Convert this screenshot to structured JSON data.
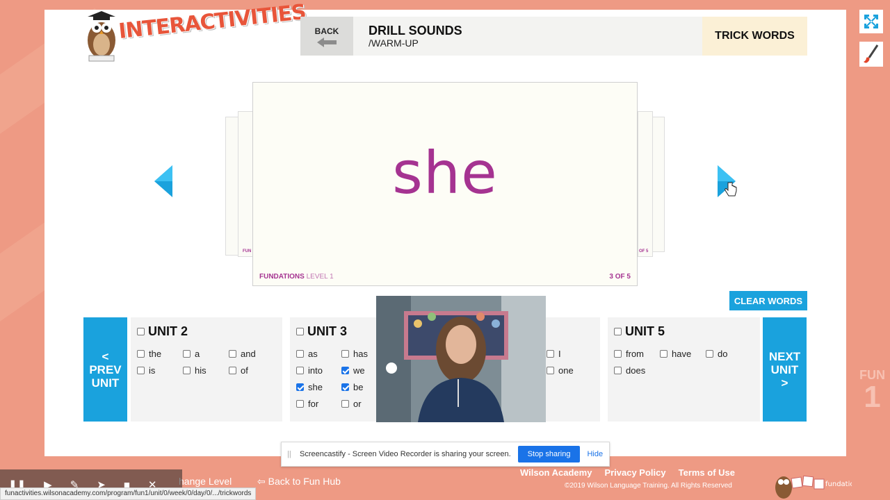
{
  "app": {
    "logo_text": "INTERACTIVITIES"
  },
  "header": {
    "back_label": "BACK",
    "title": "DRILL SOUNDS",
    "subtitle": "/WARM-UP",
    "tab_label": "TRICK WORDS"
  },
  "card": {
    "word": "she",
    "brand": "FUNDATIONS",
    "level": "LEVEL 1",
    "position": "3 OF 5",
    "ghost_label_left": "FUN",
    "ghost_label_right": "OF 5"
  },
  "controls": {
    "clear_label": "CLEAR WORDS",
    "prev_unit_label": [
      "<",
      "PREV",
      "UNIT"
    ],
    "next_unit_label": [
      "NEXT",
      "UNIT",
      ">"
    ]
  },
  "units": [
    {
      "title": "UNIT 2",
      "checked": false,
      "words": [
        {
          "text": "the",
          "checked": false
        },
        {
          "text": "a",
          "checked": false
        },
        {
          "text": "and",
          "checked": false
        },
        {
          "text": "is",
          "checked": false
        },
        {
          "text": "his",
          "checked": false
        },
        {
          "text": "of",
          "checked": false
        }
      ]
    },
    {
      "title": "UNIT 3",
      "checked": false,
      "words": [
        {
          "text": "as",
          "checked": false
        },
        {
          "text": "has",
          "checked": false
        },
        {
          "text": "into",
          "checked": false
        },
        {
          "text": "we",
          "checked": true
        },
        {
          "text": "she",
          "checked": true
        },
        {
          "text": "be",
          "checked": true
        },
        {
          "text": "for",
          "checked": false
        },
        {
          "text": "or",
          "checked": false
        }
      ]
    },
    {
      "title": "",
      "checked": false,
      "words": [
        {
          "text": "I",
          "checked": false
        },
        {
          "text": "one",
          "checked": false
        }
      ]
    },
    {
      "title": "UNIT 5",
      "checked": false,
      "words": [
        {
          "text": "from",
          "checked": false
        },
        {
          "text": "have",
          "checked": false
        },
        {
          "text": "do",
          "checked": false
        },
        {
          "text": "does",
          "checked": false
        }
      ]
    }
  ],
  "share_bar": {
    "text": "Screencastify - Screen Video Recorder is sharing your screen.",
    "stop_label": "Stop sharing",
    "hide_label": "Hide"
  },
  "footer": {
    "link1": "Wilson Academy",
    "link2": "Privacy Policy",
    "link3": "Terms of Use",
    "copyright": "©2019 Wilson Language Training. All Rights Reserved",
    "change_level": "hange Level",
    "fun_hub": "Back to Fun Hub",
    "fun1_top": "FUN",
    "fun1_num": "1",
    "fundations_logo": "fundations"
  },
  "status_url": "funactivities.wilsonacademy.com/program/fun1/unit/0/week/0/day/0/.../trickwords",
  "colors": {
    "accent_blue": "#1aa2dd",
    "card_purple": "#a53391",
    "background_salmon": "#ee9a84",
    "checkbox_blue": "#1a73e8"
  }
}
